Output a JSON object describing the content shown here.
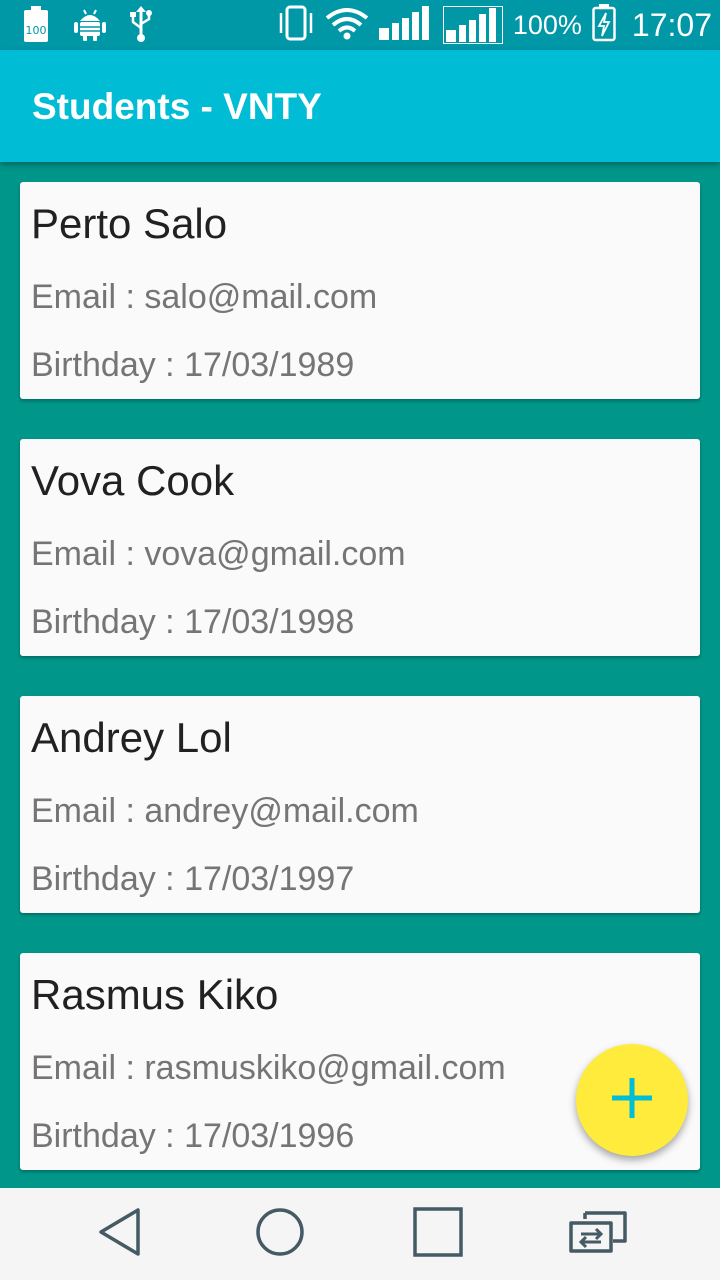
{
  "status_bar": {
    "battery_saver_label": "100",
    "battery_percent": "100%",
    "time": "17:07",
    "icons": [
      "battery-saver-icon",
      "android-debug-icon",
      "usb-icon",
      "vibrate-icon",
      "wifi-icon",
      "signal-sim1-icon",
      "signal-sim2-icon",
      "battery-charging-icon"
    ]
  },
  "app_bar": {
    "title": "Students - VNTY"
  },
  "students": [
    {
      "name": "Perto Salo",
      "email": "Email : salo@mail.com",
      "birthday": "Birthday : 17/03/1989"
    },
    {
      "name": "Vova Cook",
      "email": "Email : vova@gmail.com",
      "birthday": "Birthday : 17/03/1998"
    },
    {
      "name": "Andrey Lol",
      "email": "Email : andrey@mail.com",
      "birthday": "Birthday : 17/03/1997"
    },
    {
      "name": "Rasmus Kiko",
      "email": "Email : rasmuskiko@gmail.com",
      "birthday": "Birthday : 17/03/1996"
    }
  ],
  "fab": {
    "icon": "plus-icon"
  },
  "nav_bar": {
    "buttons": [
      "back-icon",
      "home-icon",
      "recents-icon",
      "switch-sim-icon"
    ]
  },
  "colors": {
    "status_bar": "#0097a7",
    "app_bar": "#00bcd4",
    "background": "#00968a",
    "card": "#fafafa",
    "fab": "#ffeb3b",
    "fab_icon": "#00bcd4",
    "nav_bar": "#f5f5f5"
  }
}
